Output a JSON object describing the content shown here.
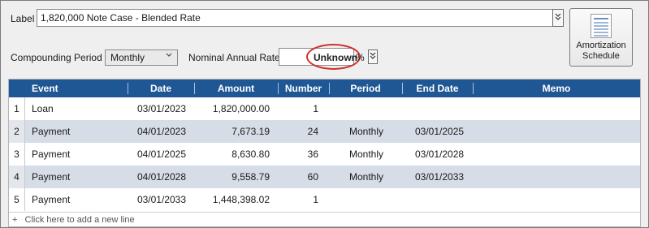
{
  "label": {
    "caption": "Label",
    "value": "1,820,000 Note Case - Blended Rate"
  },
  "controls": {
    "compounding_caption": "Compounding Period",
    "compounding_value": "Monthly",
    "nominal_caption": "Nominal Annual Rate",
    "nominal_value": "Unknown",
    "percent_sign": "%"
  },
  "amortization_button": {
    "line1": "Amortization",
    "line2": "Schedule"
  },
  "table": {
    "columns": [
      "Event",
      "Date",
      "Amount",
      "Number",
      "Period",
      "End Date",
      "Memo"
    ],
    "rows": [
      {
        "num": "1",
        "event": "Loan",
        "date": "03/01/2023",
        "amount": "1,820,000.00",
        "number": "1",
        "period": "",
        "end_date": "",
        "memo": ""
      },
      {
        "num": "2",
        "event": "Payment",
        "date": "04/01/2023",
        "amount": "7,673.19",
        "number": "24",
        "period": "Monthly",
        "end_date": "03/01/2025",
        "memo": ""
      },
      {
        "num": "3",
        "event": "Payment",
        "date": "04/01/2025",
        "amount": "8,630.80",
        "number": "36",
        "period": "Monthly",
        "end_date": "03/01/2028",
        "memo": ""
      },
      {
        "num": "4",
        "event": "Payment",
        "date": "04/01/2028",
        "amount": "9,558.79",
        "number": "60",
        "period": "Monthly",
        "end_date": "03/01/2033",
        "memo": ""
      },
      {
        "num": "5",
        "event": "Payment",
        "date": "03/01/2033",
        "amount": "1,448,398.02",
        "number": "1",
        "period": "",
        "end_date": "",
        "memo": ""
      }
    ],
    "add_line": "Click here to add a new line"
  },
  "colors": {
    "header_bg": "#1f5694",
    "alt_row_bg": "#d6dde6",
    "highlight_circle": "#d03030"
  }
}
